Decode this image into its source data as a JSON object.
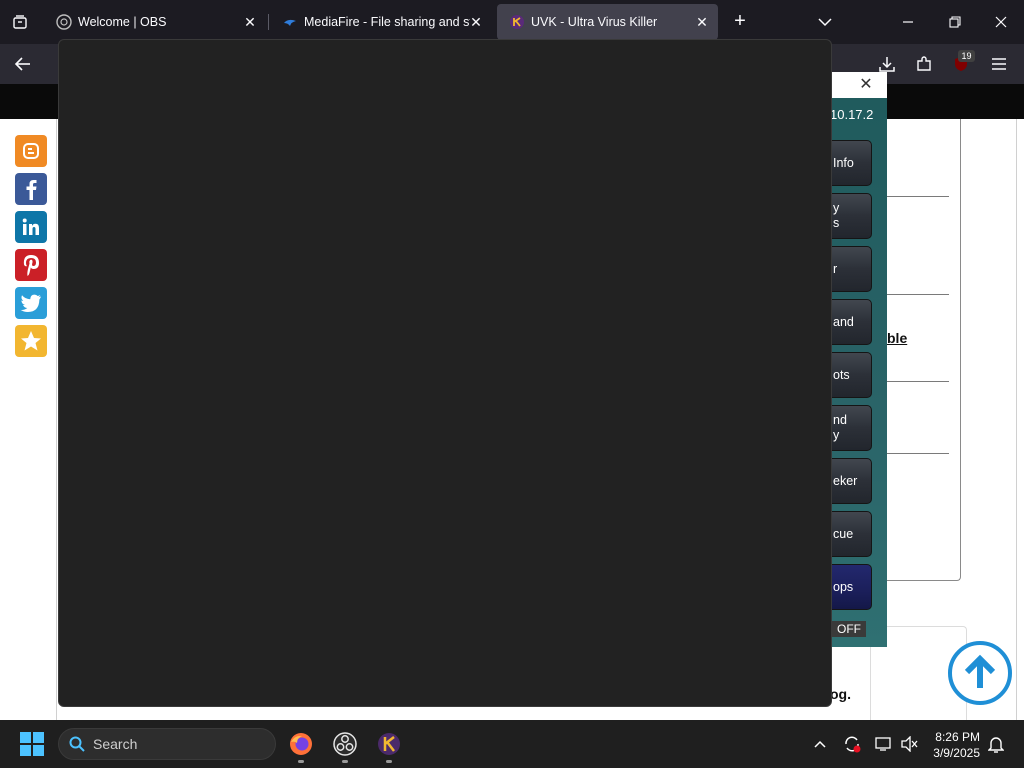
{
  "tabs": [
    {
      "title": "Welcome | OBS",
      "active": false
    },
    {
      "title": "MediaFire - File sharing and sto",
      "active": false
    },
    {
      "title": "UVK - Ultra Virus Killer",
      "active": true
    }
  ],
  "toolbar": {
    "downloads_badge": "19"
  },
  "uvk": {
    "version": "10.17.2",
    "buttons": [
      {
        "line1": "Info",
        "line2": ""
      },
      {
        "line1": "y",
        "line2": "s"
      },
      {
        "line1": "r",
        "line2": ""
      },
      {
        "line1": "and",
        "line2": ""
      },
      {
        "line1": "ots",
        "line2": ""
      },
      {
        "line1": "nd",
        "line2": "y"
      },
      {
        "line1": "eker",
        "line2": ""
      },
      {
        "line1": "cue",
        "line2": ""
      },
      {
        "line1": "ops",
        "line2": ""
      }
    ],
    "toggle": "OFF"
  },
  "page": {
    "partial_link": "ble",
    "tail_text": "og."
  },
  "taskbar": {
    "search_placeholder": "Search",
    "time": "8:26 PM",
    "date": "3/9/2025"
  },
  "colors": {
    "accent": "#1f8fd6",
    "overlay": "#222222",
    "uvk_bg": "#2a6468"
  }
}
